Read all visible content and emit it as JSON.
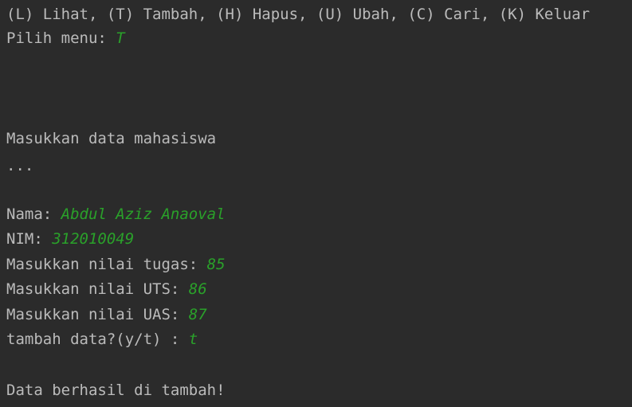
{
  "console": {
    "menu_line": "(L) Lihat, (T) Tambah, (H) Hapus, (U) Ubah, (C) Cari, (K) Keluar",
    "menu_prompt": "Pilih menu: ",
    "menu_input": "T",
    "heading": "Masukkan data mahasiswa",
    "ellipsis": "...",
    "nama_prompt": "Nama: ",
    "nama_input": "Abdul Aziz Anaoval",
    "nim_prompt": "NIM: ",
    "nim_input": "312010049",
    "tugas_prompt": "Masukkan nilai tugas: ",
    "tugas_input": "85",
    "uts_prompt": "Masukkan nilai UTS: ",
    "uts_input": "86",
    "uas_prompt": "Masukkan nilai UAS: ",
    "uas_input": "87",
    "tambah_prompt": "tambah data?(y/t) : ",
    "tambah_input": "t",
    "result": "Data berhasil di tambah!"
  },
  "colors": {
    "background": "#2b2b2b",
    "output_text": "#bbbbbb",
    "user_input": "#2aa12a"
  }
}
